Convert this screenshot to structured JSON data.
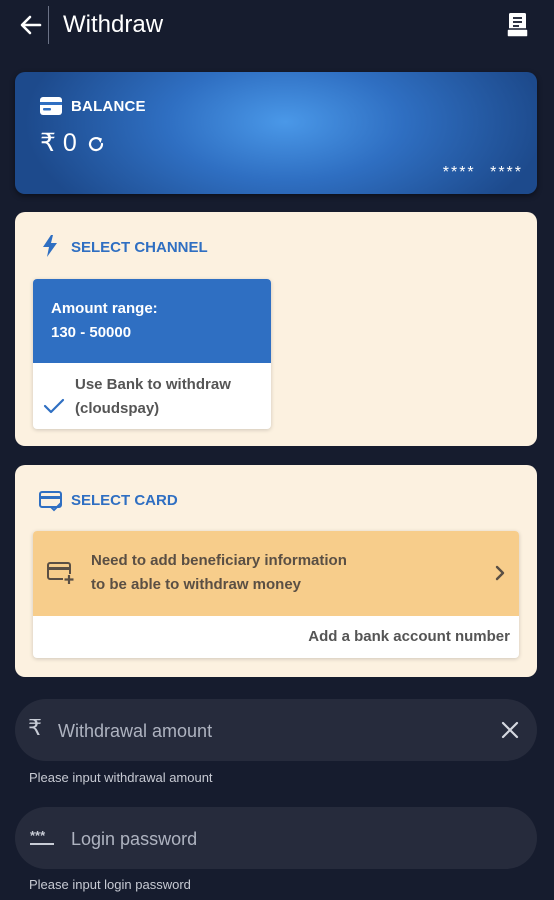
{
  "header": {
    "title": "Withdraw",
    "back_icon": "arrow-left-icon",
    "record_icon": "receipt-icon"
  },
  "balance": {
    "label": "BALANCE",
    "amount": "₹ 0",
    "card_mask": "**** ****"
  },
  "channel_section": {
    "title": "SELECT CHANNEL",
    "channel": {
      "range_label": "Amount range:",
      "range_value": "130 - 50000",
      "line1": "Use Bank to withdraw",
      "line2": "(cloudspay)",
      "selected": true
    }
  },
  "card_section": {
    "title": "SELECT CARD",
    "notice_line1": "Need to add beneficiary information",
    "notice_line2": "to be able to withdraw money",
    "add_bank": "Add a bank account number"
  },
  "form": {
    "amount_placeholder": "Withdrawal amount",
    "amount_value": "",
    "amount_hint": "Please input withdrawal amount",
    "password_placeholder": "Login password",
    "password_value": "",
    "password_hint": "Please input login password"
  },
  "colors": {
    "accent": "#2f6fc2",
    "background": "#161c2e",
    "panel": "#fcf1e0",
    "notice": "#f7cd8b"
  }
}
